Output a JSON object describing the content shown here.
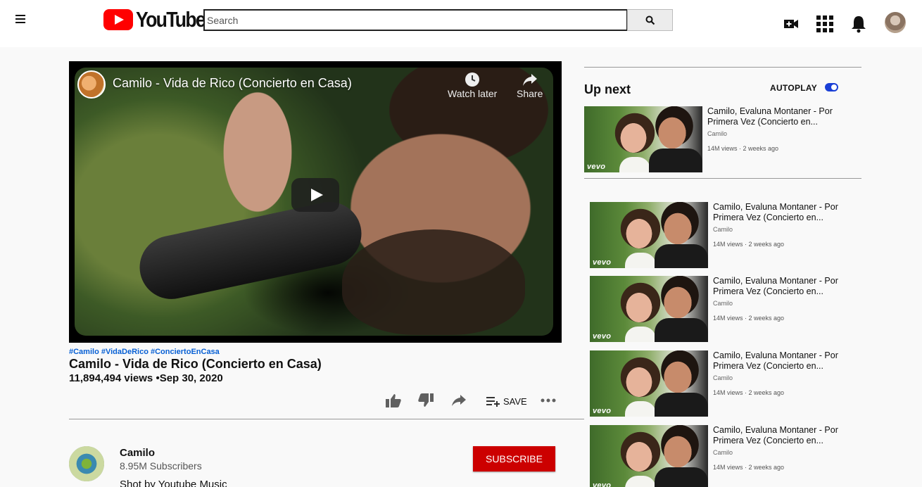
{
  "header": {
    "logo_text": "YouTube",
    "search_placeholder": "Search"
  },
  "player": {
    "title": "Camilo - Vida de Rico (Concierto en Casa)",
    "watch_later": "Watch later",
    "share": "Share"
  },
  "video": {
    "hashtags": [
      "#Camilo",
      "#VidaDeRico",
      "#ConciertoEnCasa"
    ],
    "title": "Camilo - Vida de Rico (Concierto en Casa)",
    "views_date": "11,894,494 views •Sep 30, 2020",
    "save_label": "SAVE"
  },
  "channel": {
    "name": "Camilo",
    "subscribers": "8.95M Subscribers",
    "description": "Shot by Youtube Music",
    "subscribe_label": "SUBSCRIBE"
  },
  "sidebar": {
    "up_next_label": "Up next",
    "autoplay_label": "AUTOPLAY",
    "autoplay_on": true,
    "up_next_video": {
      "title": "Camilo, Evaluna Montaner - Por Primera Vez (Concierto en...",
      "channel": "Camilo",
      "meta": "14M views · 2 weeks ago",
      "badge": "vevo"
    },
    "videos": [
      {
        "title": "Camilo, Evaluna Montaner - Por Primera Vez (Concierto en...",
        "channel": "Camilo",
        "meta": "14M views · 2 weeks ago",
        "badge": "vevo"
      },
      {
        "title": "Camilo, Evaluna Montaner - Por Primera Vez (Concierto en...",
        "channel": "Camilo",
        "meta": "14M views · 2 weeks ago",
        "badge": "vevo"
      },
      {
        "title": "Camilo, Evaluna Montaner - Por Primera Vez (Concierto en...",
        "channel": "Camilo",
        "meta": "14M views · 2 weeks ago",
        "badge": "vevo"
      },
      {
        "title": "Camilo, Evaluna Montaner - Por Primera Vez (Concierto en...",
        "channel": "Camilo",
        "meta": "14M views · 2 weeks ago",
        "badge": "vevo"
      }
    ]
  },
  "colors": {
    "brand_red": "#ff0000",
    "subscribe_red": "#cc0000",
    "link_blue": "#065fd4",
    "toggle_blue": "#1a3fd6"
  },
  "icons": [
    "menu-icon",
    "youtube-logo-icon",
    "search-icon",
    "create-video-icon",
    "apps-grid-icon",
    "bell-icon",
    "clock-icon",
    "share-arrow-icon",
    "play-icon",
    "thumbs-up-icon",
    "thumbs-down-icon",
    "playlist-add-icon",
    "more-horizontal-icon"
  ]
}
